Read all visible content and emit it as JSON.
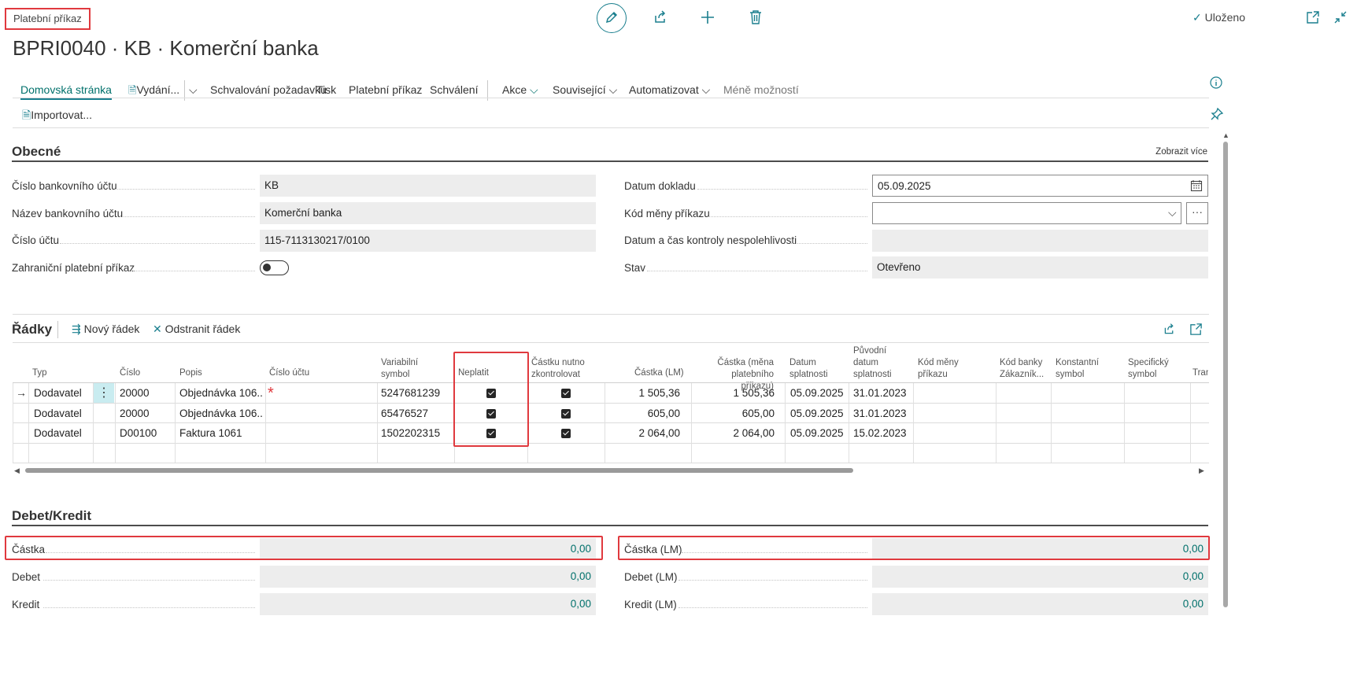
{
  "breadcrumb": "Platební příkaz",
  "title": "BPRI0040 · KB · Komerční banka",
  "status": "Uloženo",
  "action_bar": {
    "items": [
      "Domovská stránka",
      "Vydání...",
      "Schvalování požadavku",
      "Tisk",
      "Platební příkaz",
      "Schválení",
      "Akce",
      "Související",
      "Automatizovat",
      "Méně možností"
    ],
    "import": "Importovat..."
  },
  "general": {
    "title": "Obecné",
    "show_more": "Zobrazit více",
    "left": [
      {
        "label": "Číslo bankovního účtu",
        "value": "KB"
      },
      {
        "label": "Název bankovního účtu",
        "value": "Komerční banka"
      },
      {
        "label": "Číslo účtu",
        "value": "115-7113130217/0100"
      },
      {
        "label": "Zahraniční platební příkaz",
        "value": ""
      }
    ],
    "right": [
      {
        "label": "Datum dokladu",
        "value": "05.09.2025"
      },
      {
        "label": "Kód měny příkazu",
        "value": ""
      },
      {
        "label": "Datum a čas kontroly nespolehlivosti",
        "value": ""
      },
      {
        "label": "Stav",
        "value": "Otevřeno"
      }
    ]
  },
  "lines": {
    "title": "Řádky",
    "new_line": "Nový řádek",
    "delete_line": "Odstranit řádek",
    "headers": {
      "typ": "Typ",
      "cislo": "Číslo",
      "popis": "Popis",
      "cislo_uctu": "Číslo účtu",
      "var1": "Variabilní",
      "var2": "symbol",
      "neplatit": "Neplatit",
      "kontrola1": "Částku nutno",
      "kontrola2": "zkontrolovat",
      "castka_lm": "Částka (LM)",
      "castka_mena1": "Částka (měna",
      "castka_mena2": "platebního příkazu)",
      "datum1": "Datum",
      "datum2": "splatnosti",
      "puv1": "Původní",
      "puv2": "datum",
      "puv3": "splatnosti",
      "kod_meny1": "Kód měny",
      "kod_meny2": "příkazu",
      "kod_banky1": "Kód banky",
      "kod_banky2": "Zákazník...",
      "konst1": "Konstantní",
      "konst2": "symbol",
      "spec1": "Specifický",
      "spec2": "symbol",
      "tran": "Tran"
    },
    "rows": [
      {
        "typ": "Dodavatel",
        "cislo": "20000",
        "popis": "Objednávka 106...",
        "var": "5247681239",
        "castka_lm": "1 505,36",
        "castka_mena": "1 505,36",
        "datum": "05.09.2025",
        "puvodni": "31.01.2023"
      },
      {
        "typ": "Dodavatel",
        "cislo": "20000",
        "popis": "Objednávka 106...",
        "var": "65476527",
        "castka_lm": "605,00",
        "castka_mena": "605,00",
        "datum": "05.09.2025",
        "puvodni": "31.01.2023"
      },
      {
        "typ": "Dodavatel",
        "cislo": "D00100",
        "popis": "Faktura 1061",
        "var": "1502202315",
        "castka_lm": "2 064,00",
        "castka_mena": "2 064,00",
        "datum": "05.09.2025",
        "puvodni": "15.02.2023"
      }
    ]
  },
  "debit_credit": {
    "title": "Debet/Kredit",
    "left": [
      {
        "label": "Částka",
        "value": "0,00"
      },
      {
        "label": "Debet",
        "value": "0,00"
      },
      {
        "label": "Kredit",
        "value": "0,00"
      }
    ],
    "right": [
      {
        "label": "Částka (LM)",
        "value": "0,00"
      },
      {
        "label": "Debet (LM)",
        "value": "0,00"
      },
      {
        "label": "Kredit (LM)",
        "value": "0,00"
      }
    ]
  },
  "colors": {
    "accent": "#1a7f8e",
    "link": "#00706b",
    "highlight": "#e0393e"
  }
}
